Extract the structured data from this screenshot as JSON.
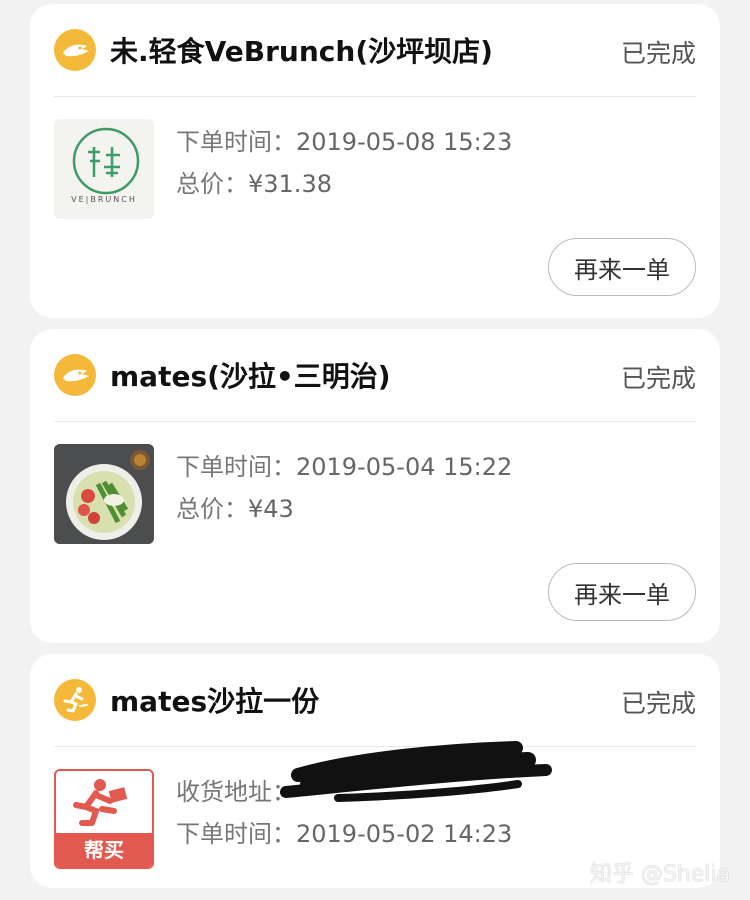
{
  "orders": [
    {
      "store_name": "未.轻食VeBrunch(沙坪坝店)",
      "status": "已完成",
      "icon": "takeaway-bird-icon",
      "thumb_brand": "VE|BRUNCH",
      "order_time_label": "下单时间：",
      "order_time": "2019-05-08 15:23",
      "total_label": "总价：",
      "total": "¥31.38",
      "reorder_label": "再来一单"
    },
    {
      "store_name": "mates(沙拉•三明治)",
      "status": "已完成",
      "icon": "takeaway-bird-icon",
      "order_time_label": "下单时间：",
      "order_time": "2019-05-04 15:22",
      "total_label": "总价：",
      "total": "¥43",
      "reorder_label": "再来一单"
    },
    {
      "store_name": "mates沙拉一份",
      "status": "已完成",
      "icon": "running-courier-icon",
      "thumb_label": "帮买",
      "address_label": "收货地址：",
      "order_time_label": "下单时间：",
      "order_time": "2019-05-02 14:23"
    }
  ],
  "watermark": "知乎 @Shelia",
  "colors": {
    "accent": "#f5b93a",
    "bangmai_red": "#e25a4f"
  }
}
